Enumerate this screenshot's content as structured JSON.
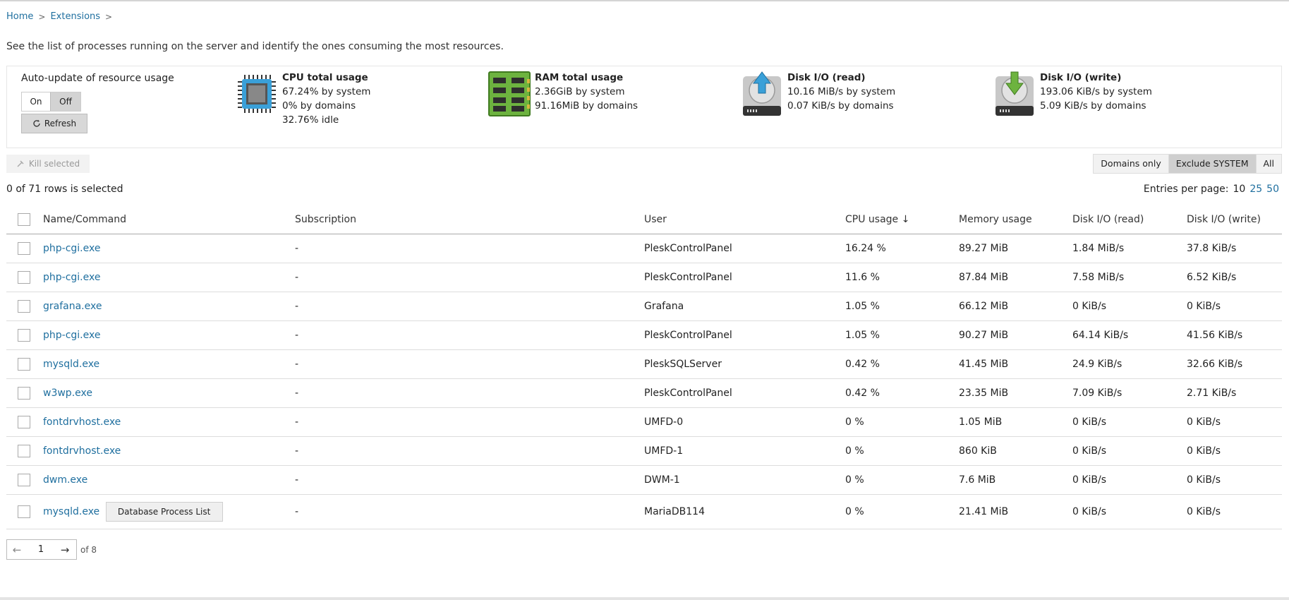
{
  "breadcrumb": {
    "home": "Home",
    "extensions": "Extensions",
    "sep": ">"
  },
  "intro": "See the list of processes running on the server and identify the ones consuming the most resources.",
  "auto_update": {
    "label": "Auto-update of resource usage",
    "on": "On",
    "off": "Off",
    "selected": "Off",
    "refresh": "Refresh"
  },
  "stats": [
    {
      "icon": "cpu-icon",
      "title": "CPU total usage",
      "lines": [
        "67.24% by system",
        "0% by domains",
        "32.76% idle"
      ]
    },
    {
      "icon": "ram-icon",
      "title": "RAM total usage",
      "lines": [
        "2.36GiB by system",
        "91.16MiB by domains"
      ]
    },
    {
      "icon": "disk-read-icon",
      "title": "Disk I/O (read)",
      "lines": [
        "10.16 MiB/s by system",
        "0.07 KiB/s by domains"
      ]
    },
    {
      "icon": "disk-write-icon",
      "title": "Disk I/O (write)",
      "lines": [
        "193.06 KiB/s by system",
        "5.09 KiB/s by domains"
      ]
    }
  ],
  "toolbar": {
    "kill": "Kill selected"
  },
  "filters": {
    "domains_only": "Domains only",
    "exclude_system": "Exclude SYSTEM",
    "all": "All",
    "active": "Exclude SYSTEM"
  },
  "selection": "0 of 71 rows is selected",
  "entries": {
    "label": "Entries per page:",
    "options": [
      "10",
      "25",
      "50"
    ],
    "current": "10"
  },
  "columns": [
    "Name/Command",
    "Subscription",
    "User",
    "CPU usage ↓",
    "Memory usage",
    "Disk I/O (read)",
    "Disk I/O (write)"
  ],
  "rows": [
    {
      "name": "php-cgi.exe",
      "sub": "-",
      "user": "PleskControlPanel",
      "cpu": "16.24 %",
      "mem": "89.27 MiB",
      "read": "1.84 MiB/s",
      "write": "37.8 KiB/s"
    },
    {
      "name": "php-cgi.exe",
      "sub": "-",
      "user": "PleskControlPanel",
      "cpu": "11.6 %",
      "mem": "87.84 MiB",
      "read": "7.58 MiB/s",
      "write": "6.52 KiB/s"
    },
    {
      "name": "grafana.exe",
      "sub": "-",
      "user": "Grafana",
      "cpu": "1.05 %",
      "mem": "66.12 MiB",
      "read": "0 KiB/s",
      "write": "0 KiB/s"
    },
    {
      "name": "php-cgi.exe",
      "sub": "-",
      "user": "PleskControlPanel",
      "cpu": "1.05 %",
      "mem": "90.27 MiB",
      "read": "64.14 KiB/s",
      "write": "41.56 KiB/s"
    },
    {
      "name": "mysqld.exe",
      "sub": "-",
      "user": "PleskSQLServer",
      "cpu": "0.42 %",
      "mem": "41.45 MiB",
      "read": "24.9 KiB/s",
      "write": "32.66 KiB/s"
    },
    {
      "name": "w3wp.exe",
      "sub": "-",
      "user": "PleskControlPanel",
      "cpu": "0.42 %",
      "mem": "23.35 MiB",
      "read": "7.09 KiB/s",
      "write": "2.71 KiB/s"
    },
    {
      "name": "fontdrvhost.exe",
      "sub": "-",
      "user": "UMFD-0",
      "cpu": "0 %",
      "mem": "1.05 MiB",
      "read": "0 KiB/s",
      "write": "0 KiB/s"
    },
    {
      "name": "fontdrvhost.exe",
      "sub": "-",
      "user": "UMFD-1",
      "cpu": "0 %",
      "mem": "860 KiB",
      "read": "0 KiB/s",
      "write": "0 KiB/s"
    },
    {
      "name": "dwm.exe",
      "sub": "-",
      "user": "DWM-1",
      "cpu": "0 %",
      "mem": "7.6 MiB",
      "read": "0 KiB/s",
      "write": "0 KiB/s"
    },
    {
      "name": "mysqld.exe",
      "sub": "-",
      "user": "MariaDB114",
      "cpu": "0 %",
      "mem": "21.41 MiB",
      "read": "0 KiB/s",
      "write": "0 KiB/s",
      "button": "Database Process List"
    }
  ],
  "pager": {
    "page": "1",
    "of": "of 8",
    "prev": "←",
    "next": "→"
  }
}
